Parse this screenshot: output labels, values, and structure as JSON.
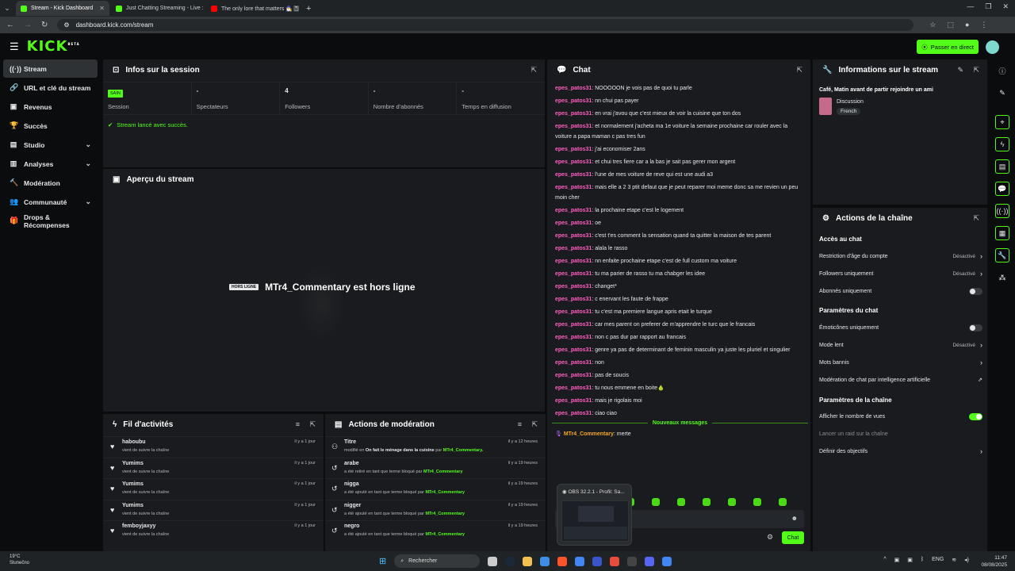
{
  "browser": {
    "tabs": [
      {
        "title": "Stream - Kick Dashboard",
        "active": true,
        "color": "#53fc18"
      },
      {
        "title": "Just Chatting Streaming - Live :",
        "active": false,
        "color": "#53fc18"
      },
      {
        "title": "The only lore that matters 🧙‍♂️📓",
        "active": false,
        "color": "#ff0000"
      }
    ],
    "url": "dashboard.kick.com/stream"
  },
  "header": {
    "logo": "KICK",
    "logo_badge": "BETA",
    "go_live": "Passer en direct"
  },
  "sidebar": {
    "items": [
      {
        "label": "Stream",
        "icon": "broadcast-icon",
        "glyph": "((·))",
        "active": true,
        "chevron": false
      },
      {
        "label": "URL et clé du stream",
        "icon": "link-icon",
        "glyph": "🔗",
        "active": false,
        "chevron": false
      },
      {
        "label": "Revenus",
        "icon": "money-icon",
        "glyph": "▣",
        "active": false,
        "chevron": false
      },
      {
        "label": "Succès",
        "icon": "trophy-icon",
        "glyph": "🏆",
        "active": false,
        "chevron": false
      },
      {
        "label": "Studio",
        "icon": "studio-icon",
        "glyph": "▤",
        "active": false,
        "chevron": true
      },
      {
        "label": "Analyses",
        "icon": "analytics-icon",
        "glyph": "▥",
        "active": false,
        "chevron": true
      },
      {
        "label": "Modération",
        "icon": "hammer-icon",
        "glyph": "🔨",
        "active": false,
        "chevron": false
      },
      {
        "label": "Communauté",
        "icon": "community-icon",
        "glyph": "👥",
        "active": false,
        "chevron": true
      },
      {
        "label": "Drops & Récompenses",
        "icon": "gift-icon",
        "glyph": "🎁",
        "active": false,
        "chevron": false
      }
    ]
  },
  "session": {
    "title": "Infos sur la session",
    "stats": [
      {
        "value": "SAIN",
        "label": "Session",
        "badge": true
      },
      {
        "value": "-",
        "label": "Spectateurs",
        "badge": false
      },
      {
        "value": "4",
        "label": "Followers",
        "badge": false
      },
      {
        "value": "-",
        "label": "Nombre d'abonnés",
        "badge": false
      },
      {
        "value": "-",
        "label": "Temps en diffusion",
        "badge": false
      }
    ],
    "success": "Stream lancé avec succès."
  },
  "preview": {
    "title": "Aperçu du stream",
    "offline_badge": "HORS LIGNE",
    "offline_text": "MTr4_Commentary est hors ligne"
  },
  "chat": {
    "title": "Chat",
    "messages": [
      {
        "user": "epes_patos31",
        "text": "NOOOOON je vois pas de quoi tu parle"
      },
      {
        "user": "epes_patos31",
        "text": "nn chui pas payer"
      },
      {
        "user": "epes_patos31",
        "text": "en vrai j'avou que c'est mieux de voir la cuisine que ton dos"
      },
      {
        "user": "epes_patos31",
        "text": "et normalement j'acheta ma 1e voiture la semaine prochaine car rouler avec la voiture a papa maman c pas tres fun"
      },
      {
        "user": "epes_patos31",
        "text": "j'ai economiser 2ans"
      },
      {
        "user": "epes_patos31",
        "text": "et chui tres fiere car a la bas je sait pas gerer mon argent"
      },
      {
        "user": "epes_patos31",
        "text": "l'une de mes voiture de reve qui est une audi a3"
      },
      {
        "user": "epes_patos31",
        "text": "mais elle a 2 3 ptit defaut que je peut reparer moi meme donc sa me revien un peu moin cher"
      },
      {
        "user": "epes_patos31",
        "text": "la prochaine etape c'est le logement"
      },
      {
        "user": "epes_patos31",
        "text": "oe"
      },
      {
        "user": "epes_patos31",
        "text": "c'est t'es comment la sensation quand ta quitter la maison de tes parent"
      },
      {
        "user": "epes_patos31",
        "text": "alala le rasso"
      },
      {
        "user": "epes_patos31",
        "text": "nn enfaite prochaine etape c'est de full custom ma voiture"
      },
      {
        "user": "epes_patos31",
        "text": "tu ma parier de rasso tu ma chabger les idee"
      },
      {
        "user": "epes_patos31",
        "text": "changet*"
      },
      {
        "user": "epes_patos31",
        "text": "c enervant les faute de frappe"
      },
      {
        "user": "epes_patos31",
        "text": "tu c'est ma premiere langue apris etait le turque"
      },
      {
        "user": "epes_patos31",
        "text": "car mes parent on preferer de m'apprendre le turc que le francais"
      },
      {
        "user": "epes_patos31",
        "text": "non c pas dur par rapport au francais"
      },
      {
        "user": "epes_patos31",
        "text": "genre ya pas de determinant de feminin masculin ya juste les pluriel et singulier"
      },
      {
        "user": "epes_patos31",
        "text": "non"
      },
      {
        "user": "epes_patos31",
        "text": "pas de soucis"
      },
      {
        "user": "epes_patos31",
        "text": "tu nous emmene en boite🍐"
      },
      {
        "user": "epes_patos31",
        "text": "mais je rigolais moi"
      },
      {
        "user": "epes_patos31",
        "text": "ciao ciao"
      }
    ],
    "new_messages": "Nouveaux messages",
    "last_message": {
      "user": "MTr4_Commentary",
      "text": "merte"
    },
    "send_label": "Chat"
  },
  "obs_preview": {
    "title": "OBS 32.2.1 - Profil: Sa..."
  },
  "activity": {
    "title": "Fil d'activités",
    "items": [
      {
        "name": "haboubu",
        "sub": "vient de suivre la chaîne",
        "time": "il y a 1 jour"
      },
      {
        "name": "Yumims",
        "sub": "vient de suivre la chaîne",
        "time": "il y a 1 jour"
      },
      {
        "name": "Yumims",
        "sub": "vient de suivre la chaîne",
        "time": "il y a 1 jour"
      },
      {
        "name": "Yumims",
        "sub": "vient de suivre la chaîne",
        "time": "il y a 1 jour"
      },
      {
        "name": "femboyjaxyy",
        "sub": "vient de suivre la chaîne",
        "time": "il y a 1 jour"
      }
    ]
  },
  "moderation": {
    "title": "Actions de modération",
    "items": [
      {
        "name": "Titre",
        "pre": "modifié en ",
        "mid": "On fait le ménage dans la cuisine",
        "post": " par ",
        "by": "MTr4_Commentary.",
        "time": "il y a 12 heures",
        "icon": "title-icon"
      },
      {
        "name": "arabe",
        "pre": "a été retiré en tant que terme bloqué par ",
        "mid": "",
        "post": "",
        "by": "MTr4_Commentary",
        "time": "il y a 19 heures",
        "icon": "undo-icon"
      },
      {
        "name": "nigga",
        "pre": "a été ajouté en tant que terme bloqué par ",
        "mid": "",
        "post": "",
        "by": "MTr4_Commentary",
        "time": "il y a 19 heures",
        "icon": "undo-icon"
      },
      {
        "name": "nigger",
        "pre": "a été ajouté en tant que terme bloqué par ",
        "mid": "",
        "post": "",
        "by": "MTr4_Commentary",
        "time": "il y a 19 heures",
        "icon": "undo-icon"
      },
      {
        "name": "negro",
        "pre": "a été ajouté en tant que terme bloqué par ",
        "mid": "",
        "post": "",
        "by": "MTr4_Commentary",
        "time": "il y a 19 heures",
        "icon": "undo-icon"
      }
    ]
  },
  "stream_info": {
    "title": "Informations sur le stream",
    "stream_title": "Café, Matin avant de partir rejoindre un ami",
    "category": "Discussion",
    "language": "French"
  },
  "channel_actions": {
    "title": "Actions de la chaîne",
    "chat_access": "Accès au chat",
    "age_restriction": "Restriction d'âge du compte",
    "age_value": "Désactivé",
    "followers_only": "Followers uniquement",
    "followers_value": "Désactivé",
    "subs_only": "Abonnés uniquement",
    "chat_params": "Paramètres du chat",
    "emotes_only": "Émoticônes uniquement",
    "slow_mode": "Mode lent",
    "slow_value": "Désactivé",
    "banned_words": "Mots bannis",
    "ai_moderation": "Modération de chat par intelligence artificielle",
    "channel_params": "Paramètres de la chaîne",
    "show_views": "Afficher le nombre de vues",
    "raid": "Lancer un raid sur la chaîne",
    "goals": "Définir des objectifs",
    "toggles": {
      "subs_only": false,
      "emotes_only": false,
      "show_views": true
    }
  },
  "taskbar": {
    "temp": "19°C",
    "weather": "Slunečno",
    "search": "Rechercher",
    "lang": "ENG",
    "time": "11:47",
    "date": "08/08/2025"
  }
}
